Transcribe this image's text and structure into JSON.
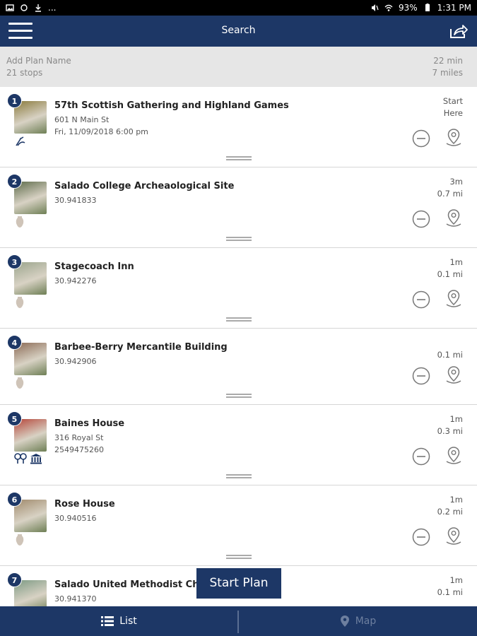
{
  "status_bar": {
    "battery": "93%",
    "time": "1:31 PM",
    "more": "..."
  },
  "app_bar": {
    "title": "Search"
  },
  "plan": {
    "name_placeholder": "Add Plan Name",
    "stops": "21 stops",
    "duration": "22 min",
    "distance": "7 miles"
  },
  "stops": [
    {
      "number": "1",
      "title": "57th Scottish Gathering and Highland Games",
      "line1": "601 N Main St",
      "line2": "Fri, 11/09/2018 6:00 pm",
      "time": "Start",
      "dist": "Here",
      "icons": [
        "event-icon"
      ],
      "thumb_color": "#8a7a3c"
    },
    {
      "number": "2",
      "title": "Salado College Archeaological Site",
      "line1": "30.941833",
      "line2": "",
      "time": "3m",
      "dist": "0.7 mi",
      "icons": [
        "artifact-icon"
      ],
      "thumb_color": "#5d6b4a"
    },
    {
      "number": "3",
      "title": "Stagecoach Inn",
      "line1": "30.942276",
      "line2": "",
      "time": "1m",
      "dist": "0.1 mi",
      "icons": [
        "artifact-icon"
      ],
      "thumb_color": "#9aa48c"
    },
    {
      "number": "4",
      "title": "Barbee-Berry Mercantile Building",
      "line1": "30.942906",
      "line2": "",
      "time": "",
      "dist": "0.1 mi",
      "icons": [
        "artifact-icon"
      ],
      "thumb_color": "#8b6a55"
    },
    {
      "number": "5",
      "title": "Baines House",
      "line1": "316 Royal St",
      "line2": "2549475260",
      "time": "1m",
      "dist": "0.3 mi",
      "icons": [
        "lodging-icon",
        "museum-icon"
      ],
      "thumb_color": "#b5463a"
    },
    {
      "number": "6",
      "title": "Rose House",
      "line1": "30.940516",
      "line2": "",
      "time": "1m",
      "dist": "0.2 mi",
      "icons": [
        "artifact-icon"
      ],
      "thumb_color": "#a08a6c"
    },
    {
      "number": "7",
      "title": "Salado United Methodist Church",
      "line1": "30.941370",
      "line2": "",
      "time": "1m",
      "dist": "0.1 mi",
      "icons": [],
      "thumb_color": "#7d9a84"
    }
  ],
  "start_plan": "Start Plan",
  "tabs": {
    "list": "List",
    "map": "Map"
  },
  "colors": {
    "brand": "#1d3766",
    "inactive_tab": "#6d7f9f",
    "divider": "#d6d6d6"
  }
}
